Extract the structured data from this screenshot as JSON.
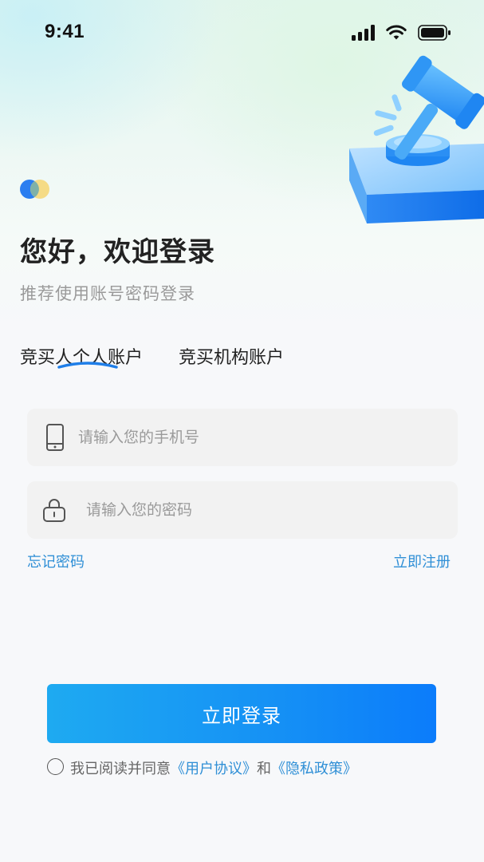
{
  "status_bar": {
    "time": "9:41"
  },
  "header": {
    "title": "您好，欢迎登录",
    "subtitle": "推荐使用账号密码登录"
  },
  "tabs": [
    {
      "label": "竞买人个人账户",
      "active": true
    },
    {
      "label": "竞买机构账户",
      "active": false
    }
  ],
  "form": {
    "phone_placeholder": "请输入您的手机号",
    "password_placeholder": "请输入您的密码",
    "forgot_label": "忘记密码",
    "register_label": "立即注册",
    "login_label": "立即登录"
  },
  "agreement": {
    "prefix": "我已阅读并同意",
    "user_agreement": "《用户协议》",
    "and": "和",
    "privacy_policy": "《隐私政策》"
  },
  "icons": {
    "phone": "phone-icon",
    "lock": "lock-icon",
    "hero": "auction-gavel-icon",
    "logo": "app-logo-icon"
  },
  "colors": {
    "accent": "#1590f5",
    "link": "#2f8fd6",
    "title": "#222222",
    "muted": "#9a9a9a"
  }
}
